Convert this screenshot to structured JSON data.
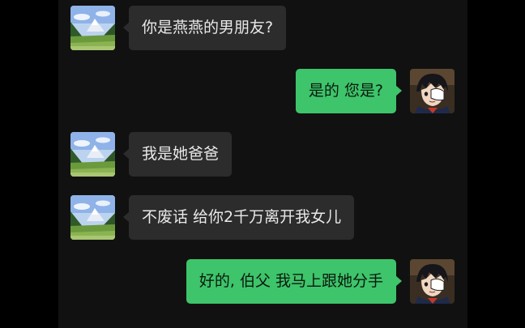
{
  "chat": {
    "messages": [
      {
        "side": "in",
        "text": "你是燕燕的男朋友?",
        "avatar": "mountain-landscape-avatar"
      },
      {
        "side": "out",
        "text": "是的 您是?",
        "avatar": "anime-boy-eyepatch-avatar"
      },
      {
        "side": "in",
        "text": "我是她爸爸",
        "avatar": "mountain-landscape-avatar"
      },
      {
        "side": "in",
        "text": "不废话 给你2千万离开我女儿",
        "avatar": "mountain-landscape-avatar"
      },
      {
        "side": "out",
        "text": "好的, 伯父 我马上跟她分手",
        "avatar": "anime-boy-eyepatch-avatar"
      }
    ]
  },
  "colors": {
    "background": "#000000",
    "chat_background": "#111111",
    "incoming_bubble": "#2c2c2c",
    "outgoing_bubble": "#3ec46a"
  }
}
